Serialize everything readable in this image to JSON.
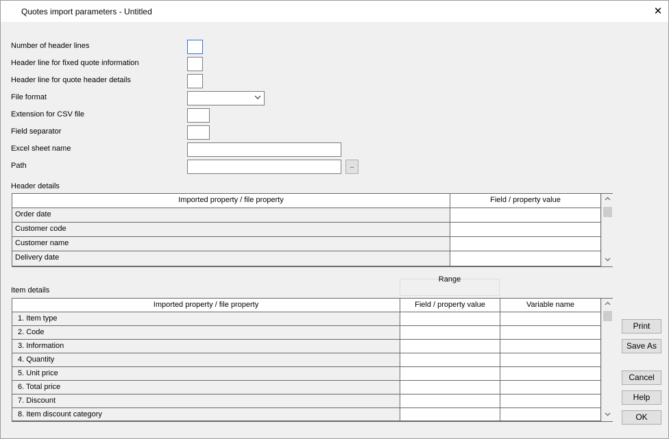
{
  "window": {
    "title": "Quotes import parameters - Untitled",
    "close_glyph": "✕"
  },
  "form": {
    "header_lines_label": "Number of header lines",
    "fixed_info_label": "Header line for fixed quote information",
    "quote_header_label": "Header line for quote header details",
    "file_format_label": "File format",
    "csv_ext_label": "Extension for CSV file",
    "separator_label": "Field separator",
    "excel_sheet_label": "Excel sheet name",
    "path_label": "Path",
    "browse_label": "..",
    "header_lines_value": "",
    "fixed_info_value": "",
    "quote_header_value": "",
    "file_format_value": "",
    "csv_ext_value": "",
    "separator_value": "",
    "excel_sheet_value": "",
    "path_value": ""
  },
  "header_details": {
    "label": "Header details",
    "col1": "Imported property / file property",
    "col2": "Field / property value",
    "rows": [
      "Order date",
      "Customer code",
      "Customer name",
      "Delivery date"
    ]
  },
  "item_details": {
    "label": "Item details",
    "range_label": "Range",
    "col1": "Imported property / file property",
    "col2": "Field / property value",
    "col3": "Variable name",
    "rows": [
      "1. Item type",
      "2. Code",
      "3. Information",
      "4. Quantity",
      "5. Unit price",
      "6. Total price",
      "7. Discount",
      "8. Item discount category"
    ]
  },
  "buttons": {
    "print": "Print",
    "save_as": "Save As",
    "cancel": "Cancel",
    "help": "Help",
    "ok": "OK"
  },
  "icons": {
    "dropdown": "chevron-down-icon",
    "close": "close-icon",
    "scroll_up": "scroll-up-icon",
    "scroll_down": "scroll-down-icon"
  }
}
